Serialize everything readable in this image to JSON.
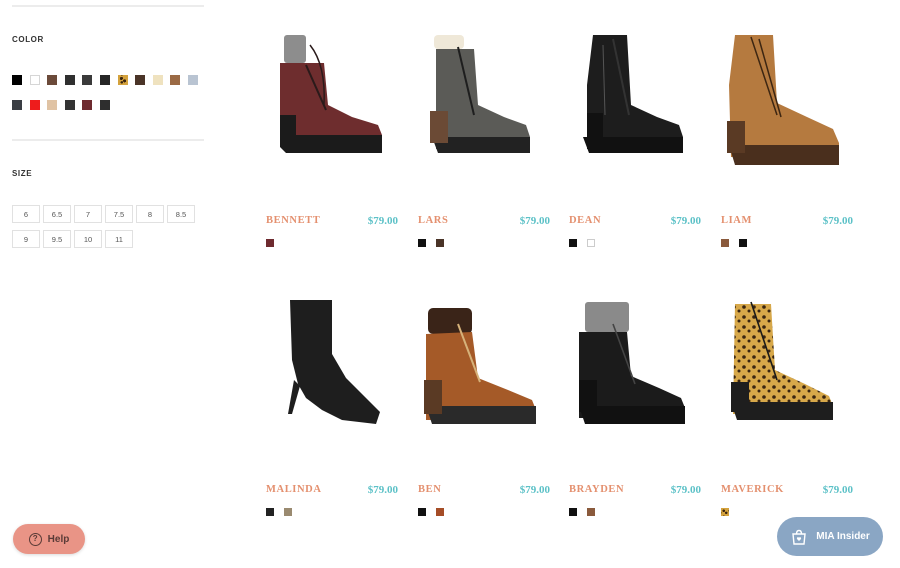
{
  "filters": {
    "color_title": "COLOR",
    "size_title": "SIZE",
    "colors_row1": [
      {
        "icon": "color-black",
        "hex": "#000000"
      },
      {
        "icon": "color-white",
        "hex": "#ffffff",
        "light": true
      },
      {
        "icon": "color-brown",
        "hex": "#6b4a3a"
      },
      {
        "icon": "color-charcoal",
        "hex": "#2f2f2f"
      },
      {
        "icon": "color-dark-gray",
        "hex": "#3a3a3a"
      },
      {
        "icon": "color-black-2",
        "hex": "#262626"
      },
      {
        "icon": "color-leopard",
        "hex": "#d4a23d",
        "pattern": "leopard"
      },
      {
        "icon": "color-dark-brown",
        "hex": "#4a3428"
      },
      {
        "icon": "color-cream",
        "hex": "#efe2bf"
      },
      {
        "icon": "color-cognac",
        "hex": "#9b6a45"
      },
      {
        "icon": "color-light-blue-gray",
        "hex": "#b9c4d2"
      }
    ],
    "colors_row2": [
      {
        "icon": "color-slate",
        "hex": "#3a3e44"
      },
      {
        "icon": "color-red",
        "hex": "#ee1c1c"
      },
      {
        "icon": "color-nude",
        "hex": "#e0c3a4"
      },
      {
        "icon": "color-graphite",
        "hex": "#333333"
      },
      {
        "icon": "color-burgundy",
        "hex": "#6e2a2f"
      },
      {
        "icon": "color-black-3",
        "hex": "#2e2e2e"
      }
    ],
    "sizes_row1": [
      "6",
      "6.5",
      "7",
      "7.5",
      "8",
      "8.5"
    ],
    "sizes_row2": [
      "9",
      "9.5",
      "10",
      "11"
    ]
  },
  "products": [
    {
      "name": "BENNETT",
      "price": "$79.00",
      "swatches": [
        {
          "hex": "#6e2a2f"
        }
      ]
    },
    {
      "name": "LARS",
      "price": "$79.00",
      "swatches": [
        {
          "hex": "#111111"
        },
        {
          "hex": "#4a3428"
        }
      ]
    },
    {
      "name": "DEAN",
      "price": "$79.00",
      "swatches": [
        {
          "hex": "#111111"
        },
        {
          "hex": "#ffffff",
          "light": true
        }
      ]
    },
    {
      "name": "LIAM",
      "price": "$79.00",
      "swatches": [
        {
          "hex": "#8a5a3c"
        },
        {
          "hex": "#111111"
        }
      ]
    },
    {
      "name": "MALINDA",
      "price": "$79.00",
      "swatches": [
        {
          "hex": "#222222"
        },
        {
          "hex": "#9a8a70"
        }
      ]
    },
    {
      "name": "BEN",
      "price": "$79.00",
      "swatches": [
        {
          "hex": "#111111"
        },
        {
          "hex": "#a54d27"
        }
      ]
    },
    {
      "name": "BRAYDEN",
      "price": "$79.00",
      "swatches": [
        {
          "hex": "#111111"
        },
        {
          "hex": "#8a5a3c"
        }
      ]
    },
    {
      "name": "MAVERICK",
      "price": "$79.00",
      "swatches": [
        {
          "hex": "#d4a23d",
          "pattern": "leopard"
        }
      ]
    }
  ],
  "help_button": {
    "label": "Help",
    "icon": "question-circle-icon"
  },
  "insider_button": {
    "label": "MIA Insider",
    "icon": "shopping-bag-heart-icon"
  },
  "colors": {
    "name_accent": "#e4906f",
    "price_accent": "#5cc1c7",
    "help_bg": "#e99486",
    "insider_bg": "#8aa6c4"
  }
}
